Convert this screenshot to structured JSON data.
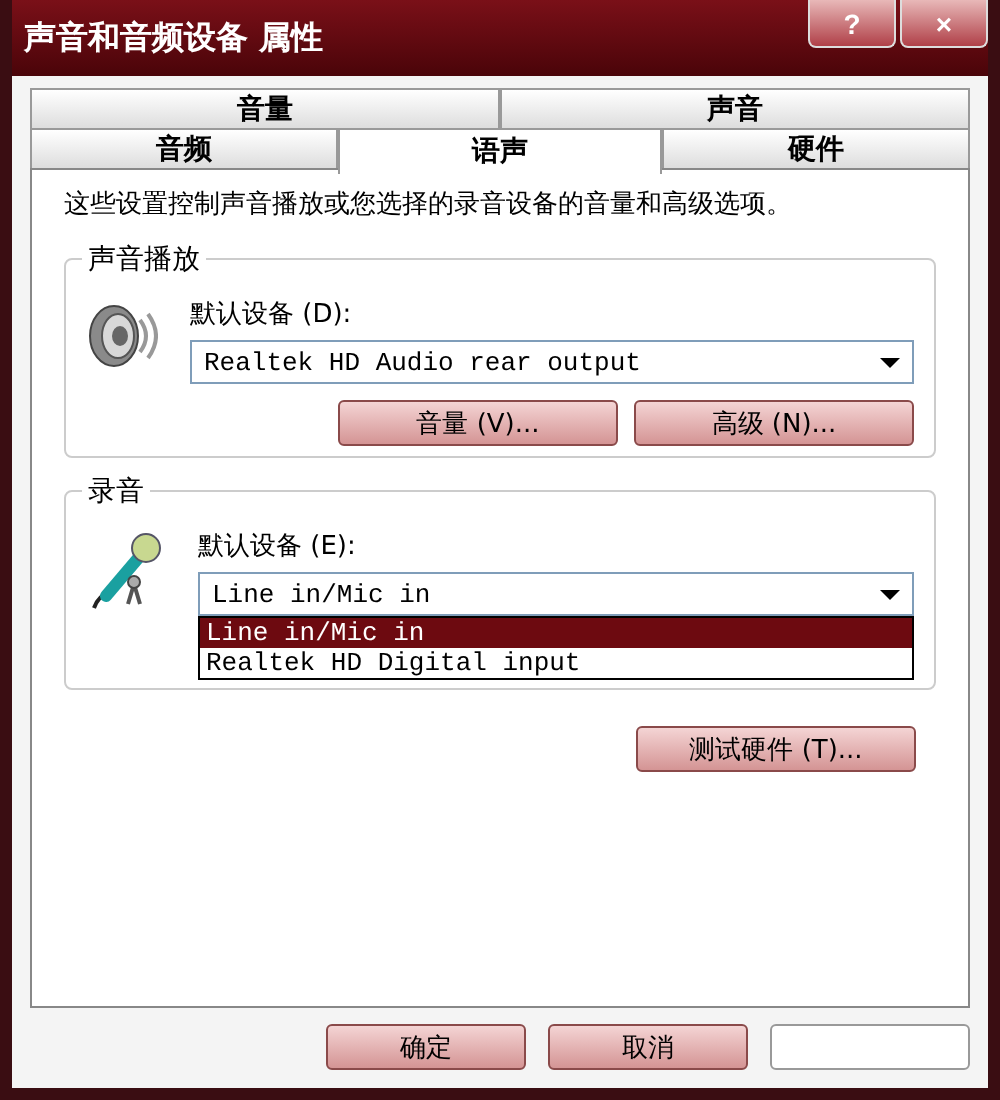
{
  "window": {
    "title": "声音和音频设备 属性",
    "help_button": "?",
    "close_button": "×"
  },
  "tab_rows": [
    [
      {
        "label": "音量",
        "selected": false
      },
      {
        "label": "声音",
        "selected": false
      }
    ],
    [
      {
        "label": "音频",
        "selected": false
      },
      {
        "label": "语声",
        "selected": true
      },
      {
        "label": "硬件",
        "selected": false
      }
    ]
  ],
  "description": "这些设置控制声音播放或您选择的录音设备的音量和高级选项。",
  "groups": [
    {
      "title": "声音播放",
      "kind": "speaker",
      "device_label": "默认设备 (D):",
      "device": "Realtek HD Audio rear output",
      "expanded": false,
      "buttons": [
        "音量 (V)...",
        "高级 (N)..."
      ]
    },
    {
      "title": "录音",
      "kind": "microphone",
      "device_label": "默认设备 (E):",
      "device": "Line in/Mic in",
      "expanded": true,
      "options": [
        {
          "label": "Line in/Mic in",
          "selected": true
        },
        {
          "label": "Realtek HD Digital input",
          "selected": false
        }
      ]
    }
  ],
  "test_button": "测试硬件 (T)...",
  "buttons": [
    {
      "label": "确定",
      "disabled": false
    },
    {
      "label": "取消",
      "disabled": false
    },
    {
      "disabled": true
    }
  ]
}
